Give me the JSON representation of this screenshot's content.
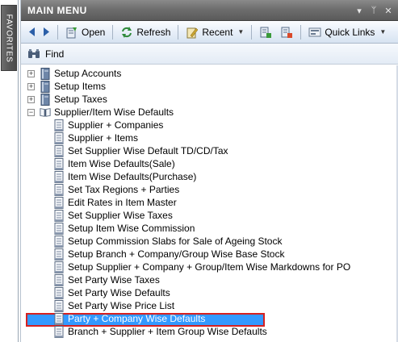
{
  "favorites": {
    "label": "FAVORITES"
  },
  "main_menu": {
    "title": "MAIN MENU",
    "window_controls": [
      "▾",
      "ᛘ",
      "✕"
    ]
  },
  "toolbar": {
    "back_icon": "back-arrow-icon",
    "forward_icon": "forward-arrow-icon",
    "open_label": "Open",
    "refresh_label": "Refresh",
    "recent_label": "Recent",
    "quick_links_label": "Quick Links"
  },
  "find": {
    "label": "Find"
  },
  "tree": {
    "items": [
      {
        "label": "Setup Accounts",
        "expander": "+"
      },
      {
        "label": "Setup Items",
        "expander": "+"
      },
      {
        "label": "Setup Taxes",
        "expander": "+"
      },
      {
        "label": "Supplier/Item Wise Defaults",
        "expander": "−"
      },
      {
        "label": "Supplier + Companies"
      },
      {
        "label": "Supplier + Items"
      },
      {
        "label": "Set Supplier Wise Default TD/CD/Tax"
      },
      {
        "label": "Item Wise Defaults(Sale)"
      },
      {
        "label": "Item Wise Defaults(Purchase)"
      },
      {
        "label": "Set Tax Regions + Parties"
      },
      {
        "label": "Edit Rates in Item Master"
      },
      {
        "label": "Set Supplier Wise Taxes"
      },
      {
        "label": "Setup Item Wise Commission"
      },
      {
        "label": "Setup Commission Slabs for Sale of Ageing Stock"
      },
      {
        "label": "Setup Branch + Company/Group Wise Base Stock"
      },
      {
        "label": "Setup Supplier + Company + Group/Item Wise Markdowns for PO"
      },
      {
        "label": "Set Party Wise Taxes"
      },
      {
        "label": "Set Party Wise Defaults"
      },
      {
        "label": "Set Party Wise Price List"
      },
      {
        "label": "Party + Company Wise Defaults",
        "selected": true
      },
      {
        "label": "Branch + Supplier + Item Group Wise Defaults"
      }
    ]
  },
  "colors": {
    "selection": "#3399ff",
    "selection_border": "#d62020",
    "title_bar": "#6e6e6e"
  }
}
